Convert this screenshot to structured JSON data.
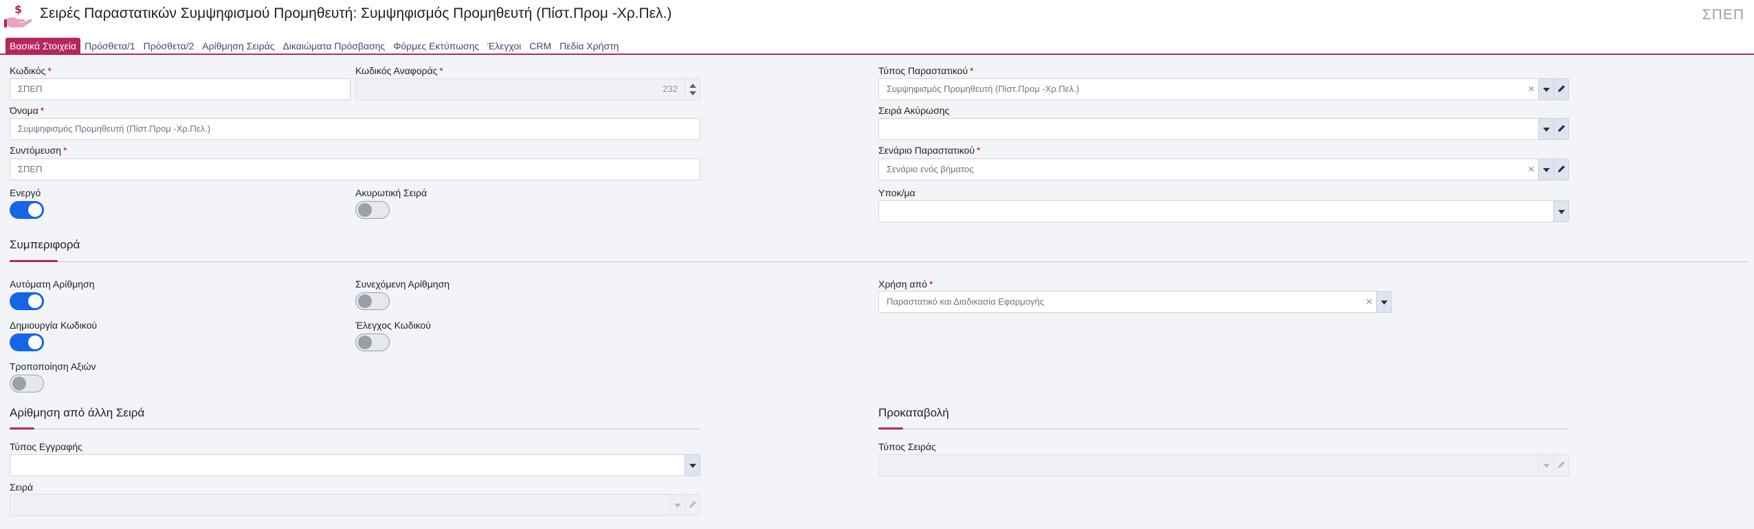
{
  "header": {
    "title": "Σειρές Παραστατικών Συμψηφισμού Προμηθευτή: Συμψηφισμός Προμηθευτή (Πίστ.Προμ -Χρ.Πελ.)",
    "code": "ΣΠΕΠ",
    "icon": "hand-dollar-icon"
  },
  "tabs": [
    {
      "label": "Βασικά Στοιχεία",
      "active": true
    },
    {
      "label": "Πρόσθετα/1"
    },
    {
      "label": "Πρόσθετα/2"
    },
    {
      "label": "Αρίθμηση Σειράς"
    },
    {
      "label": "Δικαιώματα Πρόσβασης"
    },
    {
      "label": "Φόρμες Εκτύπωσης"
    },
    {
      "label": "Έλεγχοι"
    },
    {
      "label": "CRM"
    },
    {
      "label": "Πεδία Χρήστη"
    }
  ],
  "required_marker": "*",
  "colors": {
    "accent": "#b4275c",
    "toggle_on": "#1565e6"
  },
  "fields": {
    "code": {
      "label": "Κωδικός",
      "value": "ΣΠΕΠ"
    },
    "reference_code": {
      "label": "Κωδικός Αναφοράς",
      "value": "232"
    },
    "document_type": {
      "label": "Τύπος Παραστατικού",
      "value": "Συμψηφισμός Προμηθευτή (Πίστ.Προμ -Χρ.Πελ.)"
    },
    "name": {
      "label": "Όνομα",
      "value": "Συμψηφισμός Προμηθευτή (Πίστ.Προμ -Χρ.Πελ.)"
    },
    "cancel_series": {
      "label": "Σειρά Ακύρωσης",
      "value": ""
    },
    "abbreviation": {
      "label": "Συντόμευση",
      "value": "ΣΠΕΠ"
    },
    "document_scenario": {
      "label": "Σενάριο Παραστατικού",
      "value": "Σενάριο ενός βήματος"
    },
    "active": {
      "label": "Ενεργό",
      "on": true
    },
    "cancelling_series": {
      "label": "Ακυρωτική Σειρά",
      "on": false
    },
    "branch": {
      "label": "Υποκ/μα",
      "value": ""
    }
  },
  "behavior": {
    "title": "Συμπεριφορά",
    "auto_numbering": {
      "label": "Αυτόματη Αρίθμηση",
      "on": true
    },
    "continuous_numbering": {
      "label": "Συνεχόμενη Αρίθμηση",
      "on": false
    },
    "used_by": {
      "label": "Χρήση από",
      "value": "Παραστατικό και Διαδικασία Εφαρμογής"
    },
    "code_creation": {
      "label": "Δημιουργία Κωδικού",
      "on": true
    },
    "code_check": {
      "label": "Έλεγχος Κωδικού",
      "on": false
    },
    "value_modification": {
      "label": "Τροποποίηση Αξιών",
      "on": false
    }
  },
  "numbering_from_other": {
    "title": "Αρίθμηση από άλλη Σειρά",
    "record_type": {
      "label": "Τύπος Εγγραφής",
      "value": ""
    },
    "series": {
      "label": "Σειρά",
      "value": ""
    }
  },
  "prepayment": {
    "title": "Προκαταβολή",
    "series_type": {
      "label": "Τύπος Σειράς",
      "value": ""
    }
  }
}
